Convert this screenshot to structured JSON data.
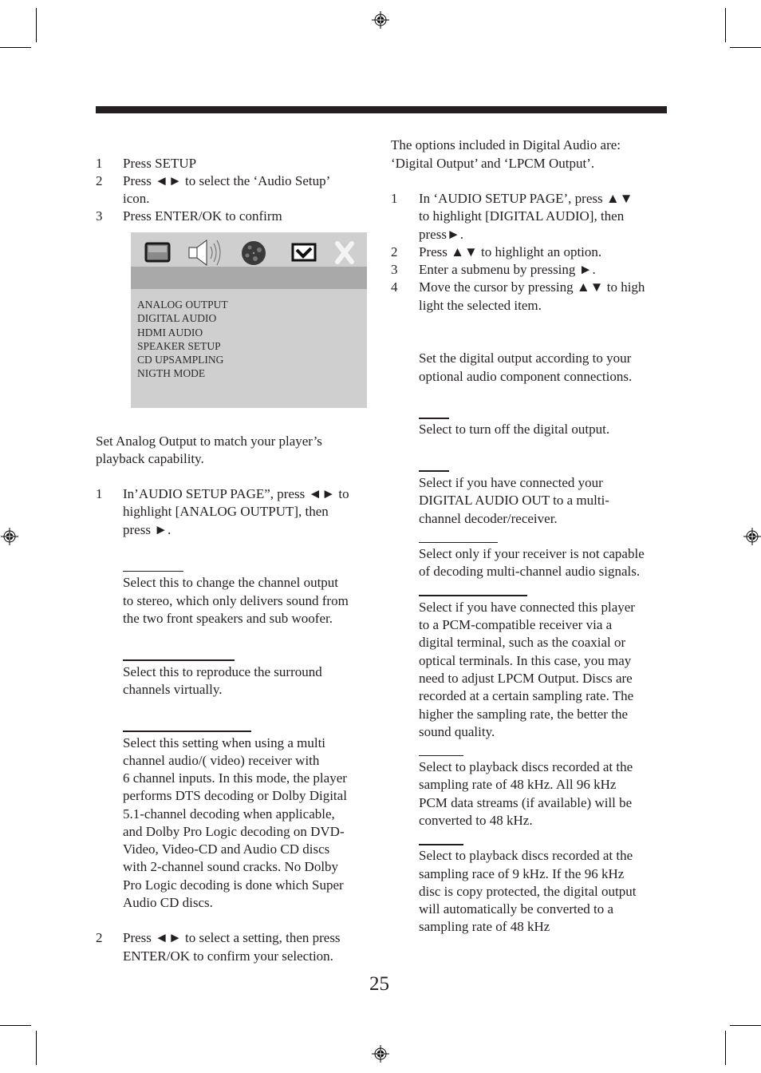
{
  "left_column": {
    "steps_a": [
      {
        "num": "1",
        "lines": [
          "Press SETUP"
        ]
      },
      {
        "num": "2",
        "lines": [
          "Press ◄► to select the ‘Audio Setup’",
          "icon."
        ]
      },
      {
        "num": "3",
        "lines": [
          "Press ENTER/OK to confirm"
        ]
      }
    ],
    "osd": {
      "icons": [
        "tv-screen-icon",
        "speaker-icon",
        "disc-reel-icon",
        "checkbox-icon",
        "close-icon"
      ],
      "menu_items": [
        "ANALOG OUTPUT",
        "DIGITAL AUDIO",
        "HDMI AUDIO",
        "SPEAKER SETUP",
        "CD UPSAMPLING",
        "NIGTH MODE"
      ]
    },
    "intro": [
      "Set Analog Output to match your player’s",
      "playback capability."
    ],
    "step_1": {
      "num": "1",
      "lines": [
        "In’AUDIO SETUP PAGE”, press ◄► to",
        "highlight [ANALOG OUTPUT], then",
        "press ►."
      ]
    },
    "option_stereo": [
      "Select this to change the channel output",
      "to stereo, which only delivers sound from",
      "the two front speakers and sub woofer."
    ],
    "option_surround": [
      "Select this to reproduce the surround",
      "channels virtually."
    ],
    "option_multichannel": [
      "Select this setting when using a multi",
      "channel audio/( video) receiver with",
      "6 channel inputs. In this mode, the player",
      "performs DTS decoding or Dolby Digital",
      "5.1-channel decoding when applicable,",
      "and Dolby Pro Logic decoding on DVD-",
      "Video, Video-CD and Audio CD discs",
      "with 2-channel sound cracks. No Dolby",
      "Pro Logic decoding is done which Super",
      "Audio CD discs."
    ],
    "step_2": {
      "num": "2",
      "lines": [
        "Press ◄► to select a setting, then press",
        "ENTER/OK to confirm your selection."
      ]
    }
  },
  "right_column": {
    "intro": [
      "The options included in Digital Audio are:",
      "‘Digital Output’ and ‘LPCM Output’."
    ],
    "steps": [
      {
        "num": "1",
        "lines": [
          "In ‘AUDIO SETUP PAGE’, press ▲▼",
          "to highlight [DIGITAL AUDIO], then",
          "press►."
        ]
      },
      {
        "num": "2",
        "lines": [
          "Press ▲▼ to highlight an option."
        ]
      },
      {
        "num": "3",
        "lines": [
          "Enter a submenu by pressing ►."
        ]
      },
      {
        "num": "4",
        "lines": [
          "Move the cursor by pressing ▲▼ to high",
          "light the selected item."
        ]
      }
    ],
    "digital_output_desc": [
      "Set the digital output according to your",
      "optional audio component connections."
    ],
    "option_off": [
      "Select to turn off the digital output."
    ],
    "option_all": [
      "Select if you have connected your",
      "DIGITAL AUDIO OUT to a multi-",
      "channel decoder/receiver."
    ],
    "option_pcm_only": [
      "Select only if your receiver is not capable",
      "of decoding multi-channel audio signals."
    ],
    "lpcm_desc": [
      "Select if you have connected this player",
      "to a PCM-compatible receiver via a",
      "digital terminal, such as the coaxial or",
      "optical terminals. In this case, you may",
      "need to adjust LPCM Output. Discs are",
      "recorded at a certain sampling rate. The",
      "higher the sampling rate, the better the",
      "sound quality."
    ],
    "option_48k": [
      "Select to playback discs recorded at the",
      "sampling rate of 48 kHz. All 96 kHz",
      "PCM data streams (if available) will be",
      "converted to 48 kHz."
    ],
    "option_96k": [
      "Select to playback discs recorded at the",
      "sampling race of 9 kHz. If the 96 kHz",
      "disc is copy protected, the digital output",
      "will automatically be converted to a",
      "sampling rate of 48 kHz"
    ]
  },
  "page_number": "25"
}
